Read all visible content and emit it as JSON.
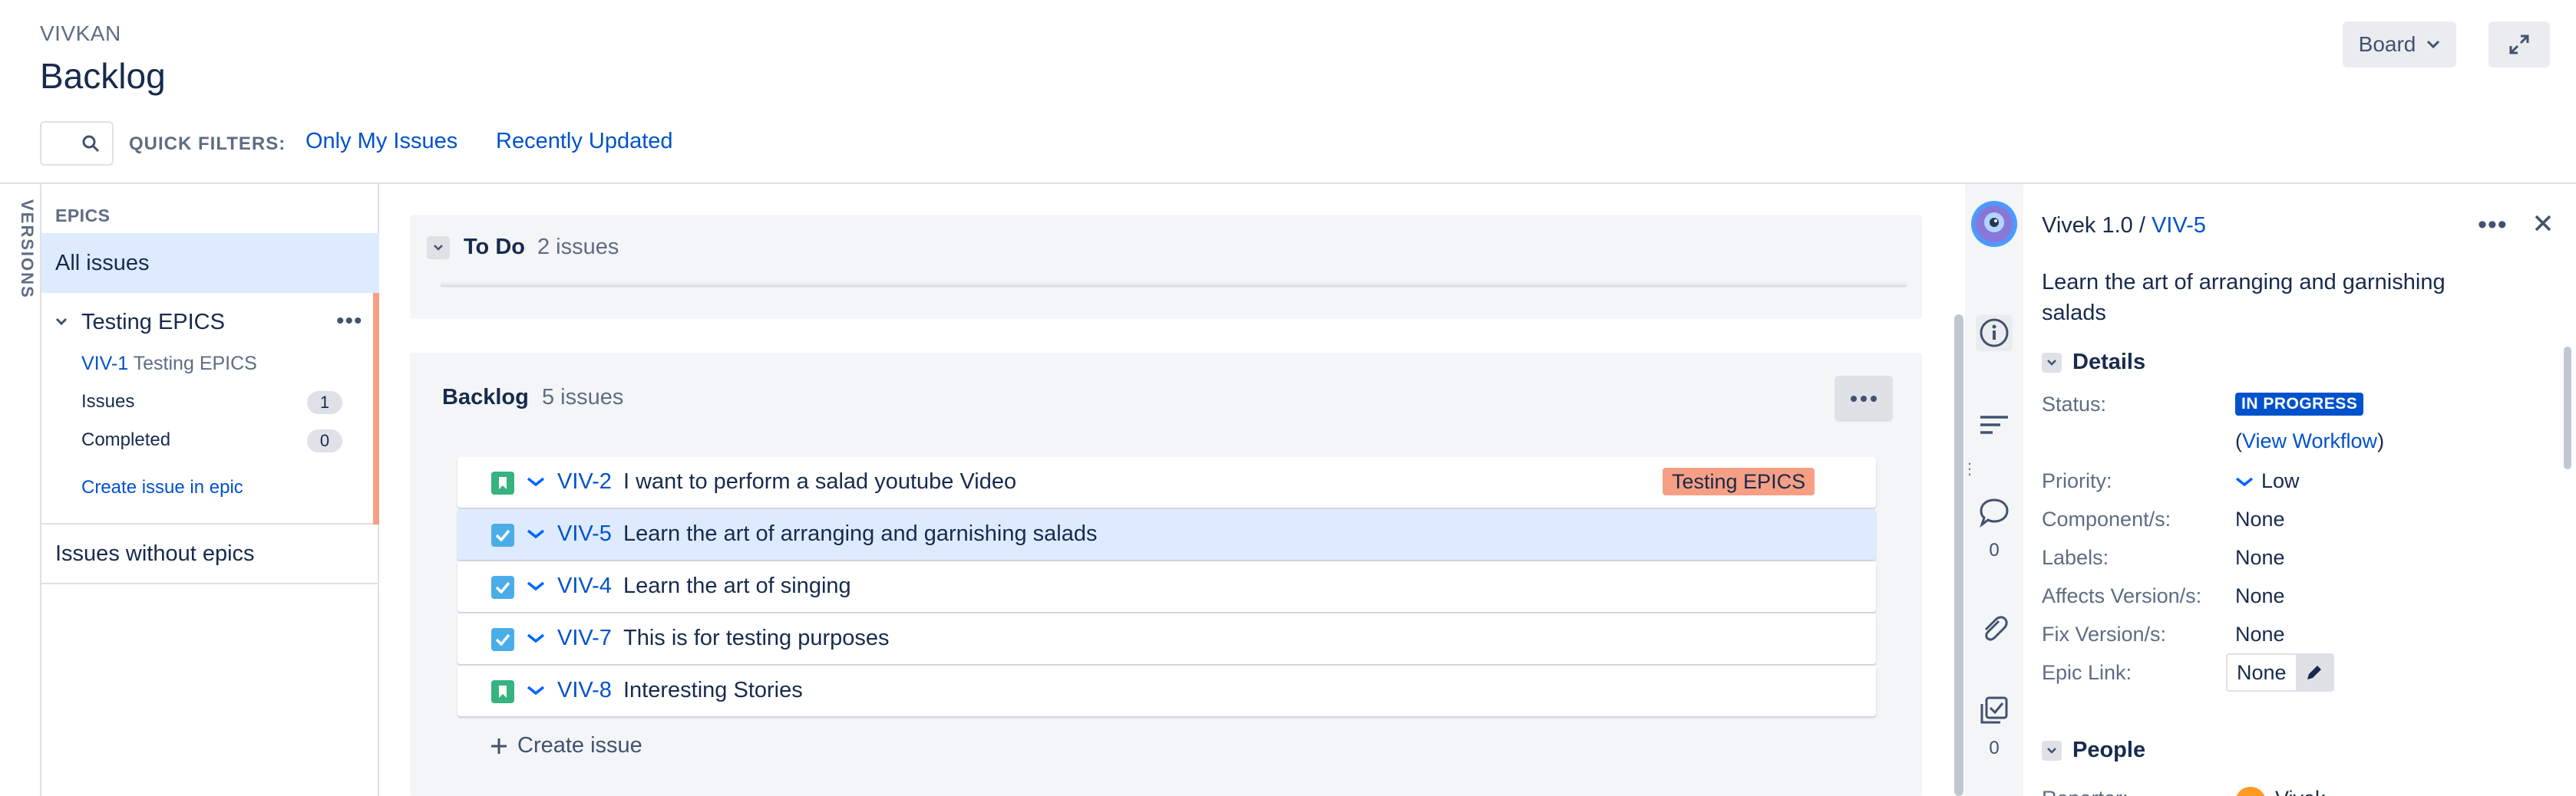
{
  "header": {
    "project_name": "VIVKAN",
    "page_title": "Backlog",
    "board_button_label": "Board",
    "quick_filters_label": "QUICK FILTERS:",
    "quick_filters": [
      "Only My Issues",
      "Recently Updated"
    ]
  },
  "sidebar": {
    "versions_label": "VERSIONS",
    "epics_label": "EPICS",
    "all_issues_label": "All issues",
    "epic": {
      "title": "Testing EPICS",
      "key": "VIV-1",
      "key_title": "Testing EPICS",
      "issues_label": "Issues",
      "issues_count": "1",
      "completed_label": "Completed",
      "completed_count": "0",
      "create_issue_label": "Create issue in epic",
      "color": "#f79f84"
    },
    "issues_without_epics_label": "Issues without epics"
  },
  "todo": {
    "title": "To Do",
    "count_label": "2 issues"
  },
  "backlog": {
    "title": "Backlog",
    "count_label": "5 issues",
    "create_issue_label": "Create issue",
    "issues": [
      {
        "type": "story",
        "key": "VIV-2",
        "summary": "I want to perform a salad youtube Video",
        "epic": "Testing EPICS",
        "priority": "low"
      },
      {
        "type": "task",
        "key": "VIV-5",
        "summary": "Learn the art of arranging and garnishing salads",
        "selected": true,
        "priority": "low"
      },
      {
        "type": "task",
        "key": "VIV-4",
        "summary": "Learn the art of singing",
        "priority": "low"
      },
      {
        "type": "task",
        "key": "VIV-7",
        "summary": "This is for testing purposes",
        "priority": "low"
      },
      {
        "type": "story",
        "key": "VIV-8",
        "summary": "Interesting Stories",
        "priority": "low"
      }
    ]
  },
  "detail_strip": {
    "icons": [
      "info-icon",
      "sort-icon",
      "comment-icon",
      "attachment-icon",
      "checklist-icon"
    ],
    "comment_count": "0",
    "checklist_count": "0"
  },
  "detail": {
    "breadcrumb_parent": "Vivek 1.0",
    "breadcrumb_separator": "/",
    "issue_key": "VIV-5",
    "summary": "Learn the art of arranging and garnishing salads",
    "details_heading": "Details",
    "fields": {
      "status_label": "Status:",
      "status_value": "IN PROGRESS",
      "view_workflow": "View Workflow",
      "priority_label": "Priority:",
      "priority_value": "Low",
      "components_label": "Component/s:",
      "components_value": "None",
      "labels_label": "Labels:",
      "labels_value": "None",
      "affects_label": "Affects Version/s:",
      "affects_value": "None",
      "fix_label": "Fix Version/s:",
      "fix_value": "None",
      "epic_link_label": "Epic Link:",
      "epic_link_value": "None"
    },
    "people_heading": "People",
    "reporter_label": "Reporter:",
    "reporter_name": "Vivek"
  },
  "colors": {
    "link": "#0052cc",
    "status_in_progress": "#0052cc",
    "story_icon": "#36b37e",
    "task_icon": "#4bade8",
    "epic": "#f79f84",
    "selected_row": "#deebff"
  }
}
